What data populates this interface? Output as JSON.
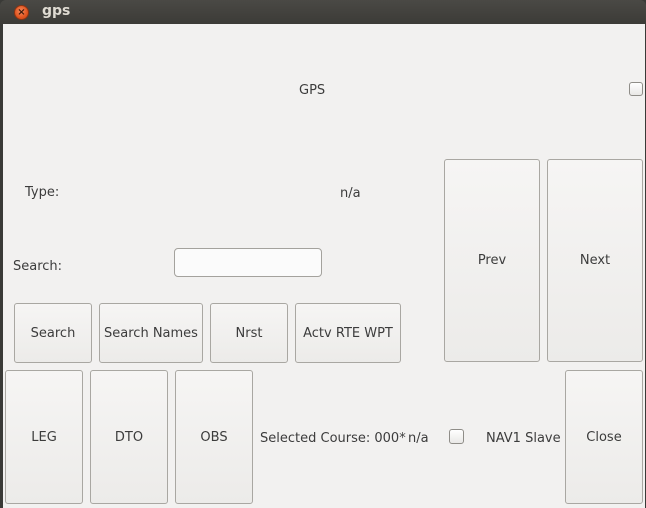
{
  "window": {
    "title": "gps"
  },
  "header": {
    "label": "GPS"
  },
  "type_row": {
    "label": "Type:",
    "value": "n/a"
  },
  "search_row": {
    "label": "Search:",
    "value": ""
  },
  "buttons": {
    "prev": "Prev",
    "next": "Next",
    "search": "Search",
    "search_names": "Search Names",
    "nrst": "Nrst",
    "actv_rte_wpt": "Actv RTE WPT",
    "leg": "LEG",
    "dto": "DTO",
    "obs": "OBS",
    "close": "Close"
  },
  "course": {
    "label": "Selected Course: 000*",
    "value": "n/a"
  },
  "nav1": {
    "label": "NAV1 Slave"
  },
  "colors": {
    "title_bar": "#3c3b37",
    "background": "#f2f1f0",
    "close_button": "#e0541f"
  }
}
